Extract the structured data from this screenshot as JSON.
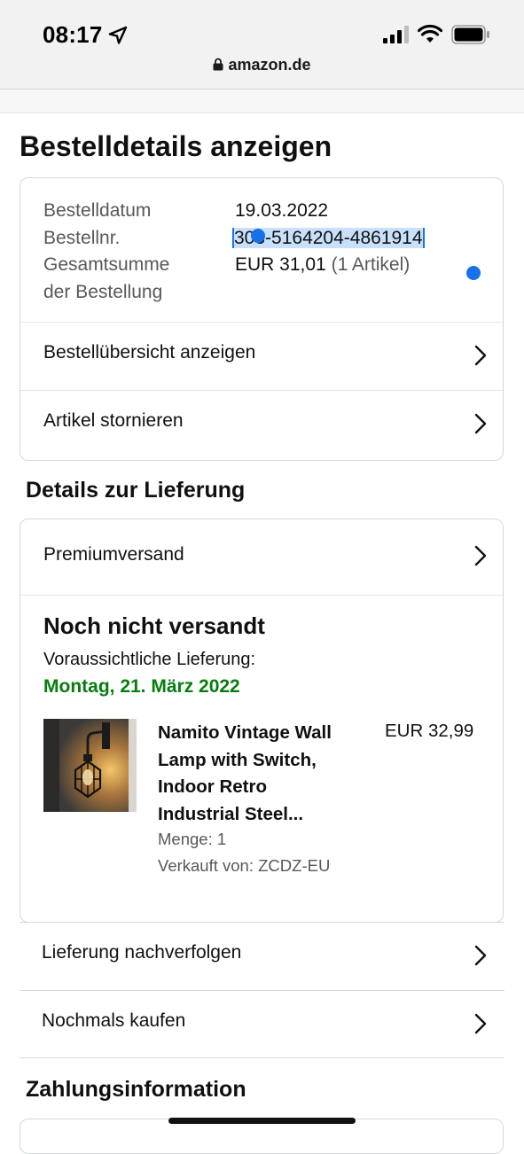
{
  "status_bar": {
    "time": "08:17",
    "icons": [
      "location-arrow-icon",
      "cellular-signal-icon",
      "wifi-icon",
      "battery-icon"
    ]
  },
  "browser": {
    "url": "amazon.de",
    "lock_icon": "lock-icon"
  },
  "page": {
    "title": "Bestelldetails anzeigen"
  },
  "order_summary": {
    "labels": {
      "date": "Bestelldatum",
      "number": "Bestellnr.",
      "total_line1": "Gesamtsumme",
      "total_line2": "der Bestellung"
    },
    "values": {
      "date": "19.03.2022",
      "number": "303-5164204-4861914",
      "total": "EUR 31,01",
      "item_count": "(1 Artikel)"
    },
    "selection_color": "#c9e0fb",
    "selection_handle_color": "#1572e8"
  },
  "order_actions": [
    {
      "label": "Bestellübersicht anzeigen"
    },
    {
      "label": "Artikel stornieren"
    }
  ],
  "delivery": {
    "section_title": "Details zur Lieferung",
    "shipping_method": "Premiumversand",
    "status": "Noch nicht versandt",
    "estimate_label": "Voraussichtliche Lieferung:",
    "estimate_date": "Montag, 21. März 2022",
    "estimate_color": "#067d0f",
    "item": {
      "title_lines": [
        "Namito Vintage Wall",
        "Lamp with Switch,",
        "Indoor Retro",
        "Industrial Steel..."
      ],
      "price": "EUR 32,99",
      "quantity": "Menge: 1",
      "seller": "Verkauft von: ZCDZ-EU"
    }
  },
  "delivery_actions": [
    {
      "label": "Lieferung nachverfolgen"
    },
    {
      "label": "Nochmals kaufen"
    }
  ],
  "payment": {
    "section_title": "Zahlungsinformation"
  }
}
